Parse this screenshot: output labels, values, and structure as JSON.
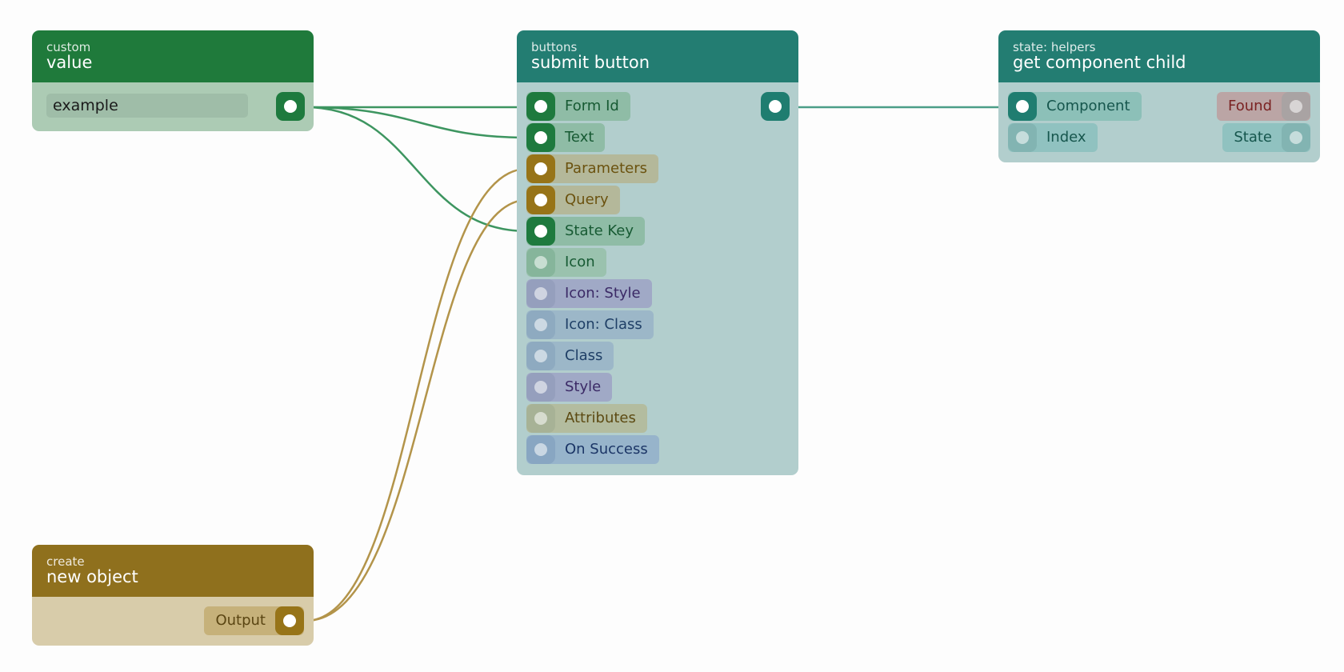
{
  "colors": {
    "string": "#1e7a3e",
    "object": "#977418",
    "component": "#1f7d70",
    "custom_header": "#1f7a3b",
    "buttons_header": "#237d72",
    "helpers_header": "#237d72",
    "create_header": "#8f701d",
    "wire_string": "#3d9560",
    "wire_object": "#b3944a",
    "wire_component": "#4b9e88"
  },
  "nodes": {
    "value": {
      "category": "custom",
      "title": "value",
      "input_value": "example"
    },
    "submit": {
      "category": "buttons",
      "title": "submit button",
      "inputs": [
        {
          "label": "Form Id",
          "connected": true,
          "type": "string"
        },
        {
          "label": "Text",
          "connected": true,
          "type": "string"
        },
        {
          "label": "Parameters",
          "connected": true,
          "type": "object"
        },
        {
          "label": "Query",
          "connected": true,
          "type": "object"
        },
        {
          "label": "State Key",
          "connected": true,
          "type": "string"
        },
        {
          "label": "Icon",
          "connected": false,
          "type": "string"
        },
        {
          "label": "Icon: Style",
          "connected": false,
          "type": "style"
        },
        {
          "label": "Icon: Class",
          "connected": false,
          "type": "class"
        },
        {
          "label": "Class",
          "connected": false,
          "type": "class"
        },
        {
          "label": "Style",
          "connected": false,
          "type": "style"
        },
        {
          "label": "Attributes",
          "connected": false,
          "type": "object"
        },
        {
          "label": "On Success",
          "connected": false,
          "type": "event"
        }
      ]
    },
    "helper": {
      "category": "state: helpers",
      "title": "get component child",
      "inputs": [
        {
          "label": "Component",
          "connected": true
        },
        {
          "label": "Index",
          "connected": false
        }
      ],
      "outputs": [
        {
          "label": "Found"
        },
        {
          "label": "State"
        }
      ]
    },
    "create": {
      "category": "create",
      "title": "new object",
      "output_label": "Output"
    }
  }
}
